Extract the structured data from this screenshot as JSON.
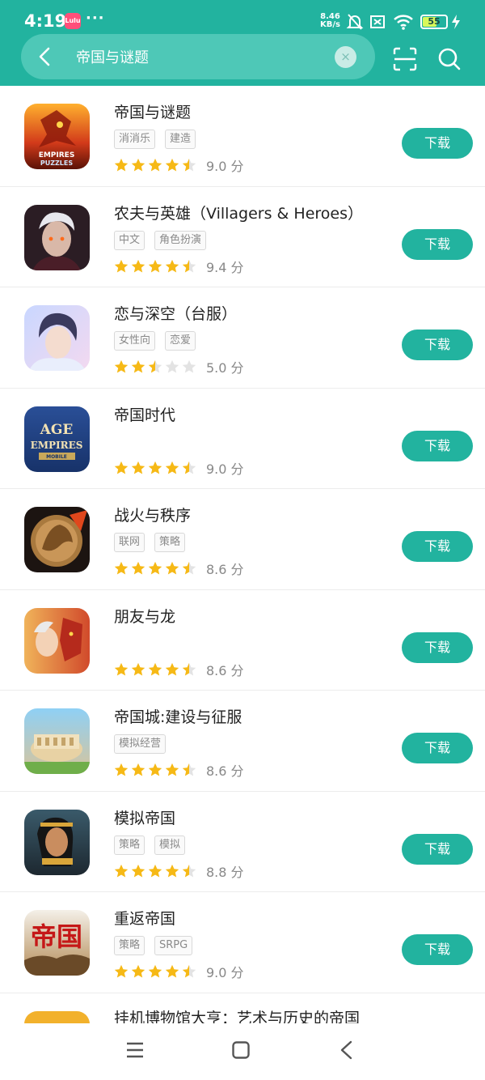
{
  "status_bar": {
    "time": "4:19",
    "app_badge": "Lulu",
    "more": "···",
    "net_speed_value": "8.46",
    "net_speed_unit": "KB/s",
    "battery": "55"
  },
  "search": {
    "query": "帝国与谜题",
    "clear_symbol": "×"
  },
  "download_label": "下载",
  "score_unit": "分",
  "apps": [
    {
      "name": "帝国与谜题",
      "tags": [
        "消消乐",
        "建造"
      ],
      "stars": 4.5,
      "score": "9.0"
    },
    {
      "name": "农夫与英雄（Villagers & Heroes）",
      "tags": [
        "中文",
        "角色扮演"
      ],
      "stars": 4.5,
      "score": "9.4"
    },
    {
      "name": "恋与深空（台服）",
      "tags": [
        "女性向",
        "恋爱"
      ],
      "stars": 2.5,
      "score": "5.0"
    },
    {
      "name": "帝国时代",
      "tags": [],
      "stars": 4.5,
      "score": "9.0"
    },
    {
      "name": "战火与秩序",
      "tags": [
        "联网",
        "策略"
      ],
      "stars": 4.5,
      "score": "8.6"
    },
    {
      "name": "朋友与龙",
      "tags": [],
      "stars": 4.5,
      "score": "8.6"
    },
    {
      "name": "帝国城:建设与征服",
      "tags": [
        "模拟经营"
      ],
      "stars": 4.5,
      "score": "8.6"
    },
    {
      "name": "模拟帝国",
      "tags": [
        "策略",
        "模拟"
      ],
      "stars": 4.5,
      "score": "8.8"
    },
    {
      "name": "重返帝国",
      "tags": [
        "策略",
        "SRPG"
      ],
      "stars": 4.5,
      "score": "9.0"
    },
    {
      "name": "挂机博物馆大亨：艺术与历史的帝国",
      "tags": [],
      "stars": null,
      "score": null
    }
  ],
  "icon_art": {
    "app_3_title": "AGE",
    "app_3_sub": "EMPIRES",
    "app_3_small": "MOBILE",
    "app_0_a": "EMPIRES",
    "app_0_b": "PUZZLES",
    "app_8_text": "帝国"
  },
  "colors": {
    "accent": "#22b39f",
    "star": "#f6b916",
    "star_empty": "#e3e3e3"
  }
}
